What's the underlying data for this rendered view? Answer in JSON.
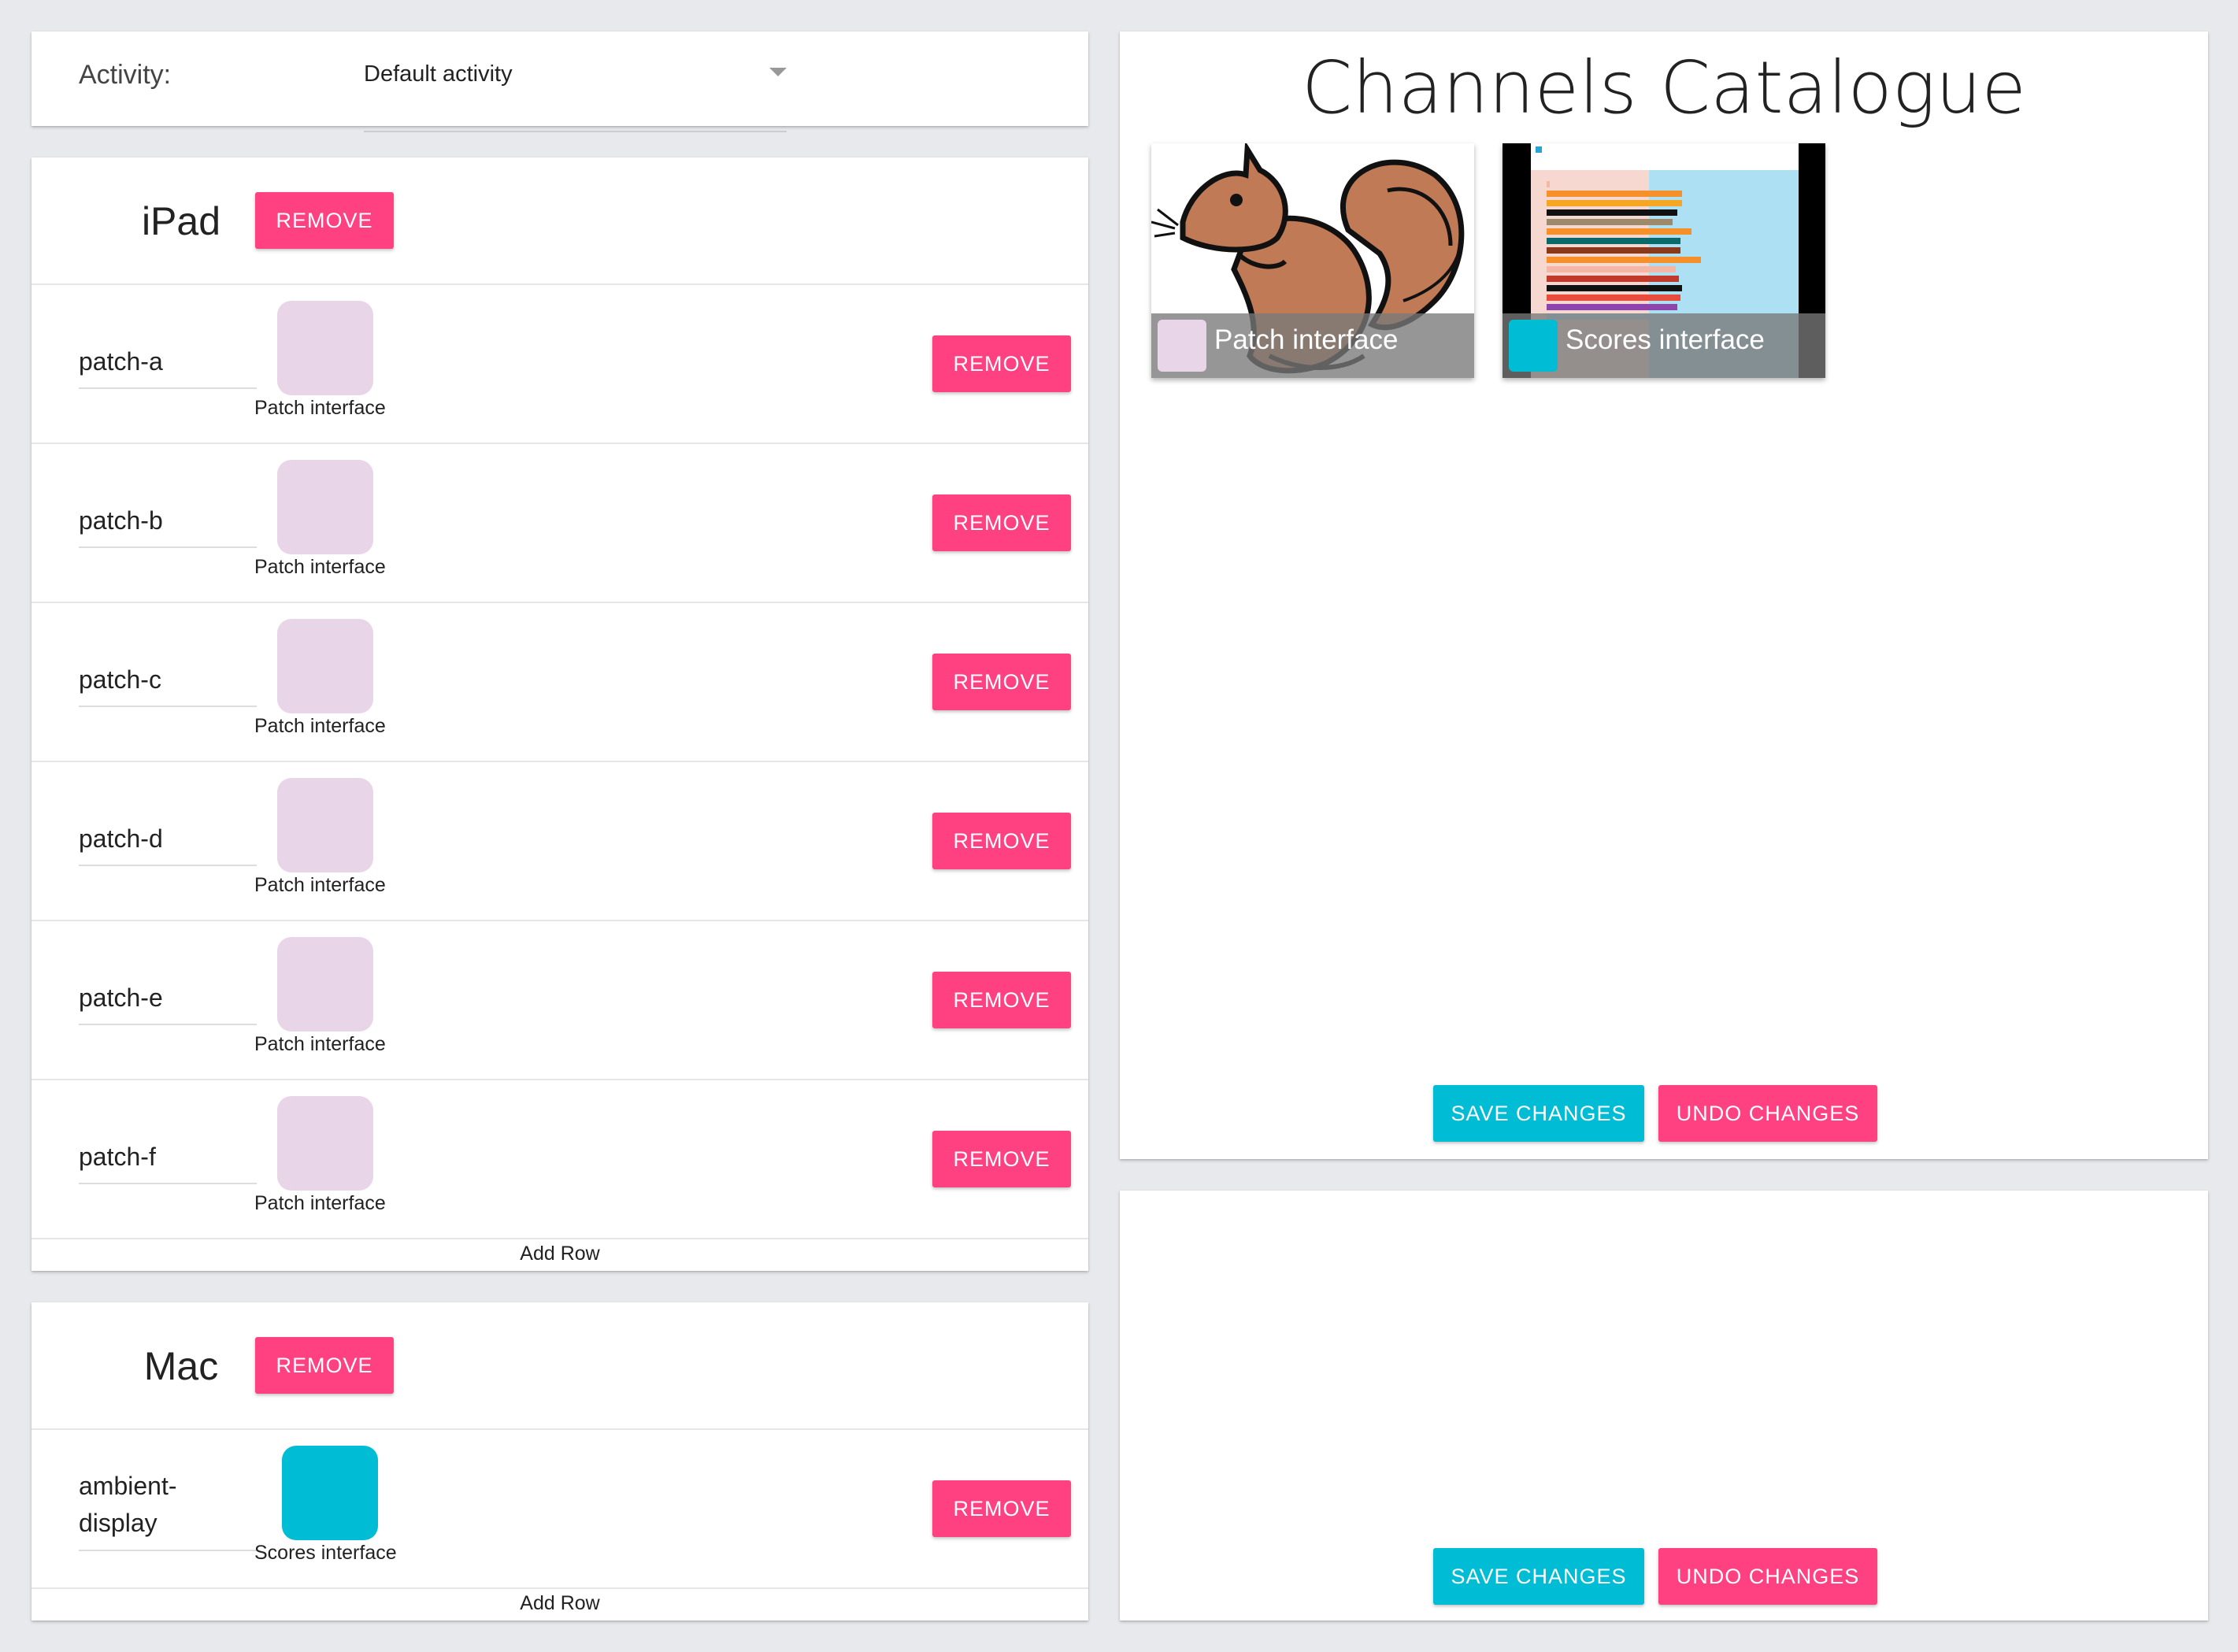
{
  "activity": {
    "label": "Activity:",
    "selected": "Default activity"
  },
  "devices": [
    {
      "name": "iPad",
      "remove_label": "REMOVE",
      "rows": [
        {
          "name": "patch-a",
          "interface": "Patch interface",
          "remove_label": "REMOVE"
        },
        {
          "name": "patch-b",
          "interface": "Patch interface",
          "remove_label": "REMOVE"
        },
        {
          "name": "patch-c",
          "interface": "Patch interface",
          "remove_label": "REMOVE"
        },
        {
          "name": "patch-d",
          "interface": "Patch interface",
          "remove_label": "REMOVE"
        },
        {
          "name": "patch-e",
          "interface": "Patch interface",
          "remove_label": "REMOVE"
        },
        {
          "name": "patch-f",
          "interface": "Patch interface",
          "remove_label": "REMOVE"
        }
      ],
      "add_row_label": "Add Row"
    },
    {
      "name": "Mac",
      "remove_label": "REMOVE",
      "rows": [
        {
          "name_line1": "ambient-",
          "name_line2": "display",
          "interface": "Scores interface",
          "remove_label": "REMOVE"
        }
      ],
      "add_row_label": "Add Row"
    }
  ],
  "catalogue": {
    "title": "Channels Catalogue",
    "tiles": [
      {
        "label": "Patch interface",
        "color": "#e8d5e8",
        "image": "squirrel-illustration"
      },
      {
        "label": "Scores interface",
        "color": "#00bcd4",
        "image": "harvest-graph-screenshot"
      }
    ],
    "save_label": "SAVE CHANGES",
    "undo_label": "UNDO CHANGES"
  },
  "lower_panel": {
    "save_label": "SAVE CHANGES",
    "undo_label": "UNDO CHANGES"
  },
  "colors": {
    "patch_chip": "#e8d5e8",
    "scores_chip": "#00bcd4",
    "accent_pink": "#ff4081",
    "accent_cyan": "#00bcd4"
  }
}
